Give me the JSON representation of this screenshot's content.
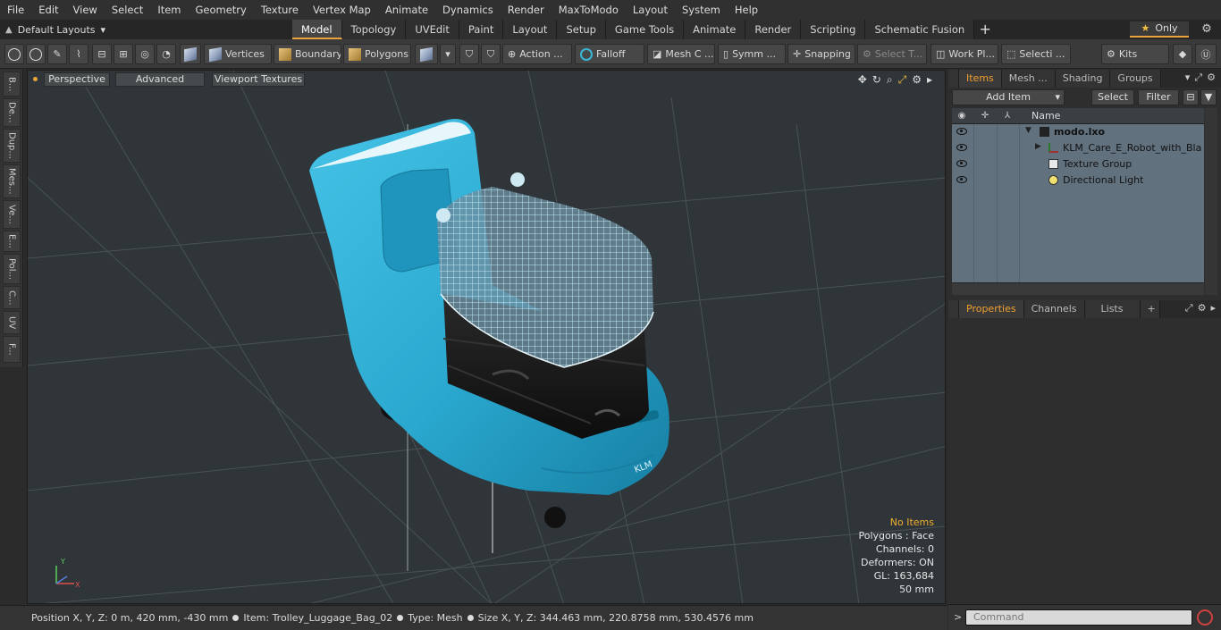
{
  "menu": [
    "File",
    "Edit",
    "View",
    "Select",
    "Item",
    "Geometry",
    "Texture",
    "Vertex Map",
    "Animate",
    "Dynamics",
    "Render",
    "MaxToModo",
    "Layout",
    "System",
    "Help"
  ],
  "layouts": {
    "label": "Default Layouts"
  },
  "tabs": [
    "Model",
    "Topology",
    "UVEdit",
    "Paint",
    "Layout",
    "Setup",
    "Game Tools",
    "Animate",
    "Render",
    "Scripting",
    "Schematic Fusion"
  ],
  "active_tab": "Model",
  "only_label": "Only",
  "toolbar": {
    "vertices": "Vertices",
    "boundary": "Boundary",
    "polygons": "Polygons",
    "action": "Action ...",
    "falloff": "Falloff",
    "mesh": "Mesh C ...",
    "symm": "Symm ...",
    "snapping": "Snapping",
    "select_t": "Select T...",
    "workpl": "Work Pl...",
    "selecti": "Selecti ...",
    "kits": "Kits"
  },
  "left_tabs": [
    "B...",
    "De...",
    "Dup...",
    "Mes...",
    "Ve...",
    "E...",
    "Pol...",
    "C...",
    "UV",
    "F..."
  ],
  "viewport": {
    "perspective": "Perspective",
    "advanced": "Advanced",
    "viewport_textures": "Viewport Textures",
    "info": {
      "no_items": "No Items",
      "polygons": "Polygons : Face",
      "channels": "Channels: 0",
      "deformers": "Deformers: ON",
      "gl": "GL: 163,684",
      "scale": "50 mm"
    }
  },
  "status": {
    "position": "Position X, Y, Z:   0 m, 420 mm, -430 mm",
    "item": "Item:  Trolley_Luggage_Bag_02",
    "type": "Type:  Mesh",
    "size": "Size X, Y, Z:   344.463 mm, 220.8758 mm, 530.4576 mm"
  },
  "items_panel": {
    "tabs": [
      "Items",
      "Mesh ...",
      "Shading",
      "Groups"
    ],
    "add_item": "Add Item",
    "select": "Select",
    "filter": "Filter",
    "col_name": "Name",
    "rows": [
      {
        "label": "modo.lxo"
      },
      {
        "label": "KLM_Care_E_Robot_with_Bla..."
      },
      {
        "label": "Texture Group"
      },
      {
        "label": "Directional Light"
      }
    ]
  },
  "props_panel": {
    "tabs": [
      "Properties",
      "Channels",
      "Lists"
    ]
  },
  "command": {
    "placeholder": "Command",
    "prompt": ">"
  },
  "colors": {
    "accent": "#e8a33b",
    "robot_body": "#2aa8cf",
    "items_list_bg": "#62717e"
  }
}
